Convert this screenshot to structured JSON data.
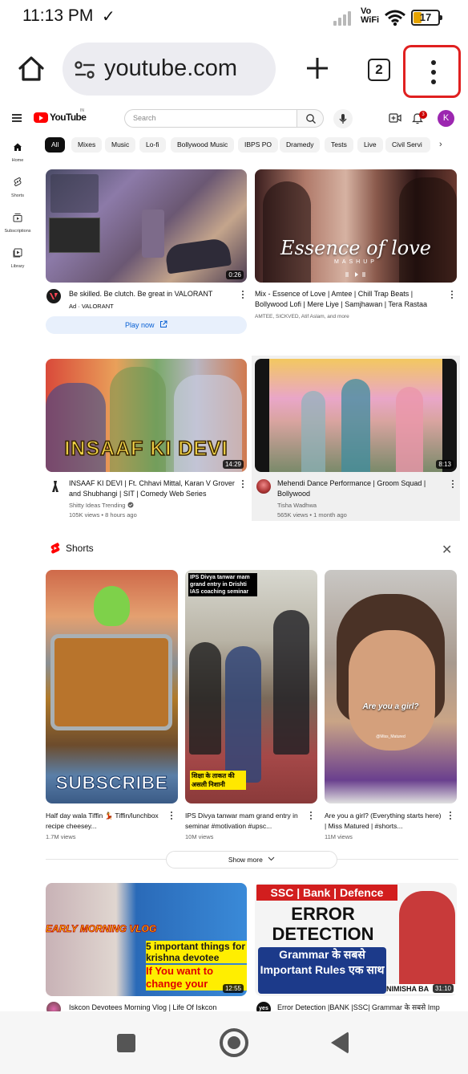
{
  "status_bar": {
    "time": "11:13 PM",
    "check_glyph": "✓",
    "vo": "Vo",
    "wifi_label": "WiFi",
    "battery": "17"
  },
  "browser": {
    "url": "youtube.com",
    "tab_count": "2"
  },
  "youtube": {
    "logo_text": "YouTube",
    "logo_country": "IN",
    "search_placeholder": "Search",
    "notification_count": "3",
    "avatar_letter": "K",
    "sidebar": [
      {
        "label": "Home",
        "icon": "home-icon"
      },
      {
        "label": "Shorts",
        "icon": "shorts-icon"
      },
      {
        "label": "Subscriptions",
        "icon": "subscriptions-icon"
      },
      {
        "label": "Library",
        "icon": "library-icon"
      }
    ],
    "chips": [
      "All",
      "Mixes",
      "Music",
      "Lo-fi",
      "Bollywood Music",
      "IBPS PO",
      "Dramedy",
      "Tests",
      "Live",
      "Civil Servi"
    ],
    "videos": [
      {
        "title": "Be skilled. Be clutch. Be great in VALORANT",
        "meta1": "Ad · VALORANT",
        "meta2": "",
        "duration": "0:26",
        "cta": "Play now"
      },
      {
        "title": "Mix - Essence of Love | Amtee | Chill Trap Beats | Bollywood Lofi | Mere Liye | Samjhawan | Tera Rastaa",
        "meta1": "AMTEE, SICKVED, Atif Aslam, and more",
        "meta2": "",
        "duration": "",
        "overlay_text": "Essence of love",
        "overlay_sub": "MASHUP"
      },
      {
        "title": "INSAAF KI DEVI | Ft. Chhavi Mittal, Karan V Grover and Shubhangi | SIT | Comedy Web Series",
        "meta1": "Shitty Ideas Trending",
        "meta2": "105K views • 8 hours ago",
        "duration": "14:29",
        "overlay_text": "INSAAF KI DEVI"
      },
      {
        "title": "Mehendi Dance Performance | Groom Squad | Bollywood",
        "meta1": "Tisha Wadhwa",
        "meta2": "565K views • 1 month ago",
        "duration": "8:13"
      }
    ],
    "shorts_label": "Shorts",
    "shorts": [
      {
        "title": "Half day wala Tiffin 💃 Tiffin/lunchbox recipe cheesey...",
        "views": "1.7M views",
        "overlay_text": "SUBSCRIBE"
      },
      {
        "title": "IPS Divya tanwar mam grand entry in seminar #motivation #upsc...",
        "views": "10M views",
        "overlay_text": "IPS Divya tanwar mam grand entry in Drishti IAS coaching seminar",
        "overlay_text2": "शिक्षा के ताकत की असली निशानी"
      },
      {
        "title": "Are you a girl? (Everything starts here) | Miss Matured | #shorts...",
        "views": "11M views",
        "overlay_text": "Are you a girl?",
        "overlay_sub": "@Miss_Matured"
      }
    ],
    "show_more": "Show more",
    "bottom_videos": [
      {
        "title": "Iskcon Devotees Morning Vlog | Life Of Iskcon",
        "duration": "12:55",
        "overlay_text": "EARLY MORNING VLOG",
        "overlay_text2": "5 important things for krishna devotee",
        "overlay_text3": "If You want to change your"
      },
      {
        "title": "Error Detection |BANK |SSC| Grammar के सबसे Imp",
        "duration": "31:10",
        "overlay_text": "SSC | Bank | Defence",
        "overlay_text2": "ERROR DETECTION",
        "overlay_text3": "Grammar के सबसे Important Rules एक साथ",
        "overlay_text4": "NIMISHA BA"
      }
    ]
  },
  "colors": {
    "accent_red": "#ff0000",
    "highlight_border": "#e02020",
    "link_blue": "#065fd4"
  }
}
